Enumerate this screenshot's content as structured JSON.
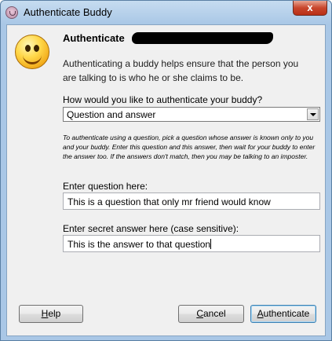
{
  "window": {
    "title": "Authenticate Buddy",
    "close_label": "x",
    "close_icon": "close-icon",
    "app_icon": "pidgin-icon"
  },
  "dialog": {
    "icon": "smiley-icon",
    "heading": "Authenticate",
    "description": "Authenticating a buddy helps ensure that the person you are talking to is who he or she claims to be.",
    "method_label": "How would you like to authenticate your buddy?",
    "method_value": "Question and answer",
    "instructions": "To authenticate using a question, pick a question whose answer is known only to you and your buddy.  Enter this question and this answer, then wait for your buddy to enter the answer too.  If the answers don't match, then you may be talking to an imposter.",
    "question_label": "Enter question here:",
    "question_value": "This is a question that only mr friend would know",
    "answer_label": "Enter secret answer here (case sensitive):",
    "answer_value": "This is the answer to that question"
  },
  "buttons": {
    "help_first": "H",
    "help_rest": "elp",
    "cancel_first": "C",
    "cancel_rest": "ancel",
    "auth_first": "A",
    "auth_rest": "uthenticate"
  }
}
